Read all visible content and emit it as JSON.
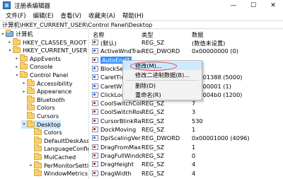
{
  "window": {
    "title": "注册表编辑器",
    "controls": [
      "—",
      "☐",
      "✕"
    ]
  },
  "menu": [
    "文件(F)",
    "编辑(E)",
    "查看(V)",
    "收藏夹(A)",
    "帮助(H)"
  ],
  "address": "计算机\\HKEY_CURRENT_USER\\Control Panel\\Desktop",
  "tree": [
    {
      "label": "计算机",
      "arrow": "▾",
      "folder": false
    },
    {
      "label": "HKEY_CLASSES_ROOT",
      "arrow": "▸"
    },
    {
      "label": "HKEY_CURRENT_USER",
      "arrow": "▾"
    },
    {
      "label": "AppEvents",
      "arrow": "▸"
    },
    {
      "label": "Console",
      "arrow": "▸"
    },
    {
      "label": "Control Panel",
      "arrow": "▾"
    },
    {
      "label": "Accessibility",
      "arrow": "▸"
    },
    {
      "label": "Appearance",
      "arrow": "▸"
    },
    {
      "label": "Bluetooth",
      "arrow": ""
    },
    {
      "label": "Colors",
      "arrow": ""
    },
    {
      "label": "Cursors",
      "arrow": ""
    },
    {
      "label": "Desktop",
      "arrow": "▾",
      "selected": true
    },
    {
      "label": "Colors",
      "arrow": ""
    },
    {
      "label": "DefaultDeskAss",
      "arrow": ""
    },
    {
      "label": "LanguageConfig",
      "arrow": ""
    },
    {
      "label": "MuiCached",
      "arrow": ""
    },
    {
      "label": "PerMonitorSetti",
      "arrow": "▸"
    },
    {
      "label": "WindowMetrics",
      "arrow": ""
    }
  ],
  "list": {
    "headers": {
      "name": "名称",
      "type": "类型",
      "data": "数据"
    },
    "rows": [
      {
        "name": "(默认)",
        "type": "REG_SZ",
        "data": "(数值未设置)",
        "kind": "sz"
      },
      {
        "name": "ActiveWndTrac...",
        "type": "REG_DWORD",
        "data": "0x00000000 (0)",
        "kind": "bin"
      },
      {
        "name": "AutoEndT",
        "type": "",
        "data": "",
        "kind": "sz",
        "highlighted": true
      },
      {
        "name": "BlockSen",
        "type": "",
        "data": "",
        "kind": "bin"
      },
      {
        "name": "CaretTim",
        "type": "",
        "data": "00001388 (5000)",
        "kind": "bin"
      },
      {
        "name": "CaretWid",
        "type": "",
        "data": "00000001 (1)",
        "kind": "bin"
      },
      {
        "name": "ClickLoc",
        "type": "",
        "data": "000004b0 (1200)",
        "kind": "bin"
      },
      {
        "name": "CoolSwitchCol...",
        "type": "REG_SZ",
        "data": "7",
        "kind": "sz"
      },
      {
        "name": "CoolSwitchRows",
        "type": "REG_SZ",
        "data": "3",
        "kind": "sz"
      },
      {
        "name": "CursorBlinkRate",
        "type": "REG_SZ",
        "data": "530",
        "kind": "sz"
      },
      {
        "name": "DockMoving",
        "type": "REG_SZ",
        "data": "1",
        "kind": "sz"
      },
      {
        "name": "DpiScalingVer",
        "type": "REG_DWORD",
        "data": "0x00001000 (4096)",
        "kind": "bin"
      },
      {
        "name": "DragFromMaxi...",
        "type": "REG_SZ",
        "data": "1",
        "kind": "sz"
      },
      {
        "name": "DragFullWindo...",
        "type": "REG_SZ",
        "data": "0",
        "kind": "sz"
      },
      {
        "name": "DragHeight",
        "type": "REG_SZ",
        "data": "4",
        "kind": "sz"
      },
      {
        "name": "DragWidth",
        "type": "REG_SZ",
        "data": "4",
        "kind": "sz"
      }
    ]
  },
  "context_menu": {
    "items": [
      "修改(M)...",
      "修改二进制数据(B)...",
      "删除(D)",
      "重命名(R)"
    ],
    "hover_index": 0
  }
}
